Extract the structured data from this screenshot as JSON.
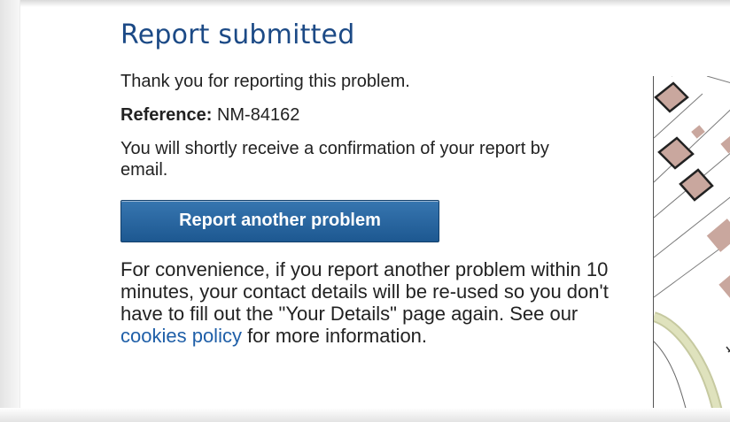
{
  "page": {
    "title": "Report submitted",
    "thanks": "Thank you for reporting this problem.",
    "reference_label": "Reference:",
    "reference_value": "NM-84162",
    "confirmation": "You will shortly receive a confirmation of your report by email.",
    "report_button_label": "Report another problem",
    "convenience_text_before": "For convenience, if you report another problem within 10 minutes, your contact details will be re-used so you don't have to fill out the \"Your Details\" page again. See our ",
    "cookies_link": "cookies policy",
    "convenience_text_after": " for more information."
  },
  "map": {
    "icon": "map-thumbnail",
    "building_color": "#c9a79e",
    "path_color": "#d9ddb0"
  },
  "colors": {
    "title": "#1c4a86",
    "button": "#2a66a0",
    "link": "#1f5fa8"
  }
}
